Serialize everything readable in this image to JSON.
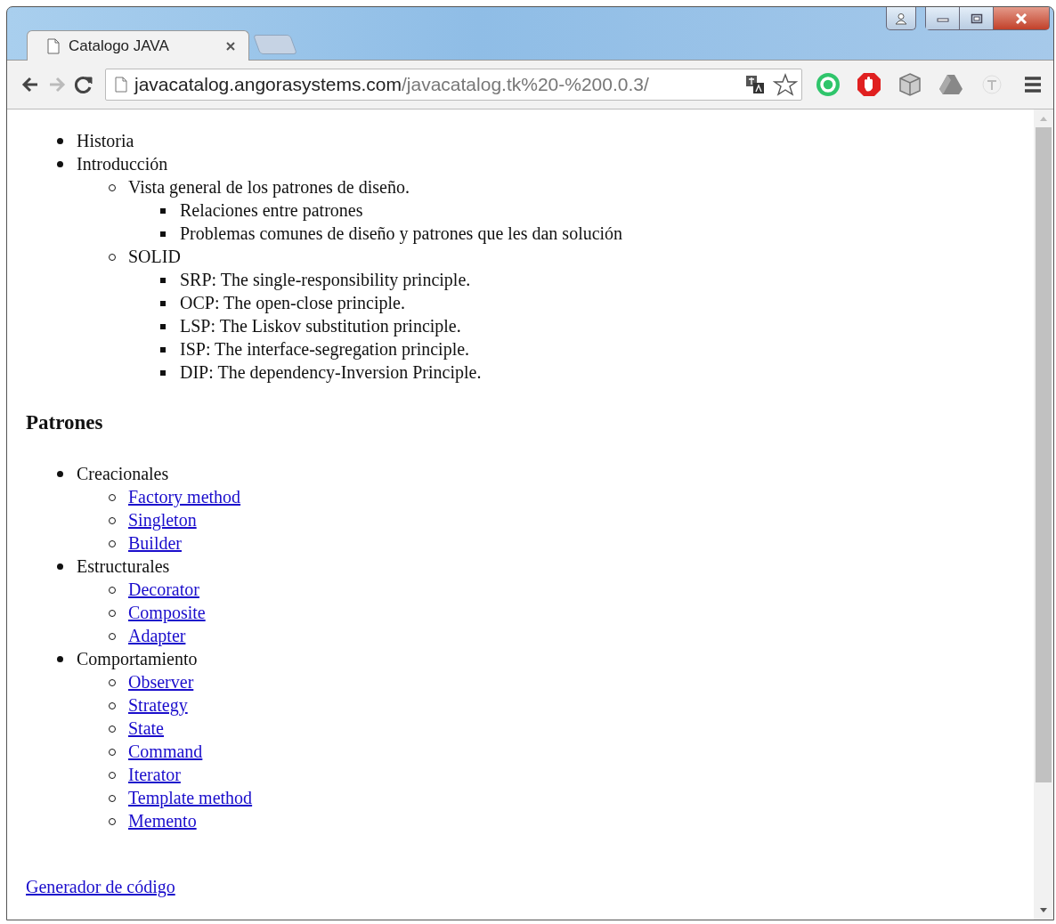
{
  "browser": {
    "tab": {
      "title": "Catalogo JAVA",
      "selected": true
    },
    "navigation": {
      "back_disabled": false,
      "forward_disabled": true
    },
    "address": {
      "host": "javacatalog.angorasystems.com",
      "path": "/javacatalog.tk%20-%200.0.3/"
    }
  },
  "page": {
    "outline": [
      {
        "kind": "text",
        "text": "Historia"
      },
      {
        "kind": "text",
        "text": "Introducción",
        "children": [
          {
            "kind": "text",
            "text": "Vista general de los patrones de diseño.",
            "children": [
              {
                "kind": "text",
                "text": "Relaciones entre patrones"
              },
              {
                "kind": "text",
                "text": "Problemas comunes de diseño y patrones que les dan solución"
              }
            ]
          },
          {
            "kind": "text",
            "text": "SOLID",
            "children": [
              {
                "kind": "text",
                "text": "SRP: The single-responsibility principle."
              },
              {
                "kind": "text",
                "text": "OCP: The open-close principle."
              },
              {
                "kind": "text",
                "text": "LSP: The Liskov substitution principle."
              },
              {
                "kind": "text",
                "text": "ISP: The interface-segregation principle."
              },
              {
                "kind": "text",
                "text": "DIP: The dependency-Inversion Principle."
              }
            ]
          }
        ]
      }
    ],
    "heading": "Patrones",
    "patterns": [
      {
        "kind": "text",
        "text": "Creacionales",
        "children": [
          {
            "kind": "link",
            "text": "Factory method"
          },
          {
            "kind": "link",
            "text": "Singleton"
          },
          {
            "kind": "link",
            "text": "Builder"
          }
        ]
      },
      {
        "kind": "text",
        "text": "Estructurales",
        "children": [
          {
            "kind": "link",
            "text": "Decorator"
          },
          {
            "kind": "link",
            "text": "Composite"
          },
          {
            "kind": "link",
            "text": "Adapter"
          }
        ]
      },
      {
        "kind": "text",
        "text": "Comportamiento",
        "children": [
          {
            "kind": "link",
            "text": "Observer"
          },
          {
            "kind": "link",
            "text": "Strategy"
          },
          {
            "kind": "link",
            "text": "State"
          },
          {
            "kind": "link",
            "text": "Command"
          },
          {
            "kind": "link",
            "text": "Iterator"
          },
          {
            "kind": "link",
            "text": "Template method"
          },
          {
            "kind": "link",
            "text": "Memento"
          }
        ]
      }
    ],
    "footer_link": "Generador de código"
  }
}
